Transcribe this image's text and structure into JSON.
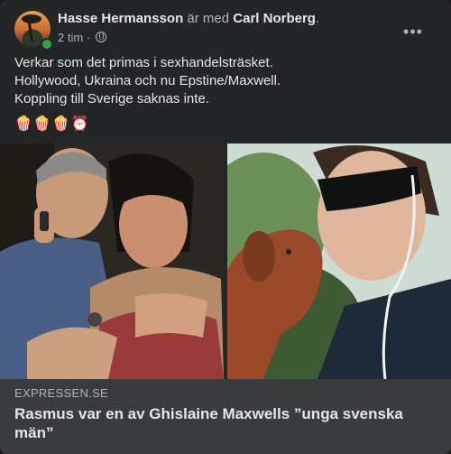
{
  "post": {
    "author": "Hasse Hermansson",
    "with_text": "är med",
    "tagged": "Carl Norberg",
    "period": ".",
    "time": "2 tim",
    "dot": "·",
    "privacy_icon": "globe-icon",
    "text_lines": [
      "Verkar som det primas i sexhandelsträsket.",
      "Hollywood, Ukraina och nu Epstine/Maxwell.",
      "Koppling till Sverige saknas inte."
    ],
    "emojis": "🍿🍿🍿⏰",
    "more_label": "•••"
  },
  "link": {
    "domain": "EXPRESSEN.SE",
    "title": "Rasmus var en av Ghislaine Maxwells ”unga svenska män”"
  },
  "colors": {
    "background": "#18191a",
    "card": "#242526",
    "link_bar": "#3a3b3c",
    "online": "#31a24c",
    "text": "#e4e6eb",
    "muted": "#b0b3b8"
  }
}
